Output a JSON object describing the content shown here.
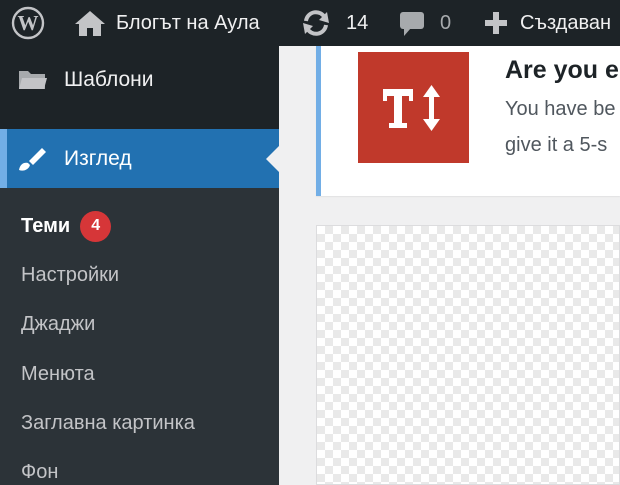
{
  "adminbar": {
    "wp_logo": "wordpress-icon",
    "site_icon": "home-icon",
    "site_name": "Блогът на Аула",
    "updates_icon": "refresh-icon",
    "updates_count": "14",
    "comments_icon": "comment-icon",
    "comments_count": "0",
    "new_icon": "plus-icon",
    "new_label": "Създаван"
  },
  "sidebar": {
    "templates_label": "Шаблони",
    "templates_icon": "folder-icon",
    "appearance_label": "Изглед",
    "appearance_icon": "paintbrush-icon",
    "submenu": [
      {
        "label": "Теми",
        "badge": "4"
      },
      {
        "label": "Настройки"
      },
      {
        "label": "Джаджи"
      },
      {
        "label": "Менюта"
      },
      {
        "label": "Заглавна картинка"
      },
      {
        "label": "Фон"
      }
    ]
  },
  "notice": {
    "icon": "text-resize-icon",
    "title": "Are you e",
    "line1": "You have be",
    "line2": "give it a 5-s"
  },
  "colors": {
    "adminbar_bg": "#1d2327",
    "menu_current_bg": "#2271b1",
    "badge_bg": "#d63638",
    "notice_icon_bg": "#c0392b",
    "notice_border": "#72aee6"
  }
}
